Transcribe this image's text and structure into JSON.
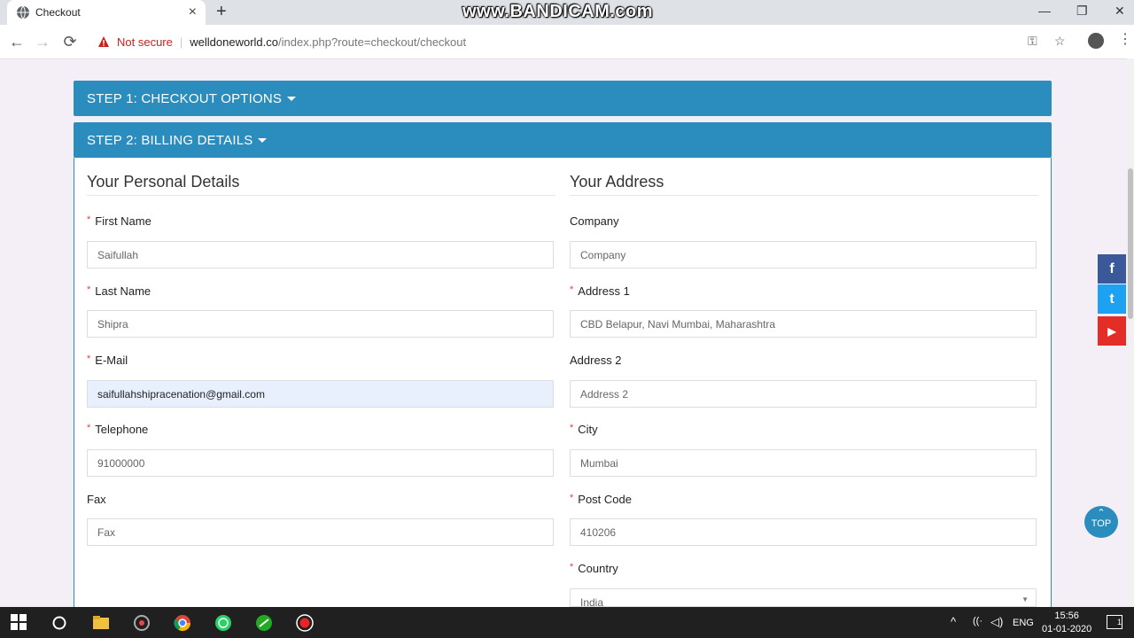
{
  "browser": {
    "tab_title": "Checkout",
    "tab_close": "×",
    "new_tab": "+",
    "watermark": "www.BANDICAM.com",
    "security_label": "Not secure",
    "url_host": "welldoneworld.co",
    "url_path": "/index.php?route=checkout/checkout",
    "back": "←",
    "forward": "→",
    "reload": "⟳",
    "key": "⚿",
    "star": "☆",
    "menu": "⋮",
    "minimize": "—",
    "restore": "❐",
    "close": "✕"
  },
  "steps": [
    {
      "label": "STEP 1: CHECKOUT OPTIONS"
    },
    {
      "label": "STEP 2: BILLING DETAILS"
    }
  ],
  "personal": {
    "legend": "Your Personal Details",
    "fields": [
      {
        "label": "First Name",
        "required": true,
        "value": "Saifullah"
      },
      {
        "label": "Last Name",
        "required": true,
        "value": "Shipra"
      },
      {
        "label": "E-Mail",
        "required": true,
        "value": "saifullahshipracenation@gmail.com"
      },
      {
        "label": "Telephone",
        "required": true,
        "value": "91000000"
      },
      {
        "label": "Fax",
        "required": false,
        "value": "Fax"
      }
    ]
  },
  "address": {
    "legend": "Your Address",
    "fields": [
      {
        "label": "Company",
        "required": false,
        "value": "Company"
      },
      {
        "label": "Address 1",
        "required": true,
        "value": "CBD Belapur, Navi Mumbai, Maharashtra"
      },
      {
        "label": "Address 2",
        "required": false,
        "value": "Address 2"
      },
      {
        "label": "City",
        "required": true,
        "value": "Mumbai"
      },
      {
        "label": "Post Code",
        "required": true,
        "value": "410206"
      },
      {
        "label": "Country",
        "required": true,
        "value": "India"
      }
    ]
  },
  "required_mark": "*",
  "social": {
    "facebook": "f",
    "twitter": "t",
    "youtube": "▶"
  },
  "top_button": {
    "arrow": "⌃",
    "label": "TOP"
  },
  "taskbar": {
    "lang": "ENG",
    "time": "15:56",
    "date": "01-01-2020",
    "notifications": "1"
  },
  "colors": {
    "accent": "#2b8cbe",
    "required": "#e04040",
    "autofill": "#e8f0fe"
  }
}
